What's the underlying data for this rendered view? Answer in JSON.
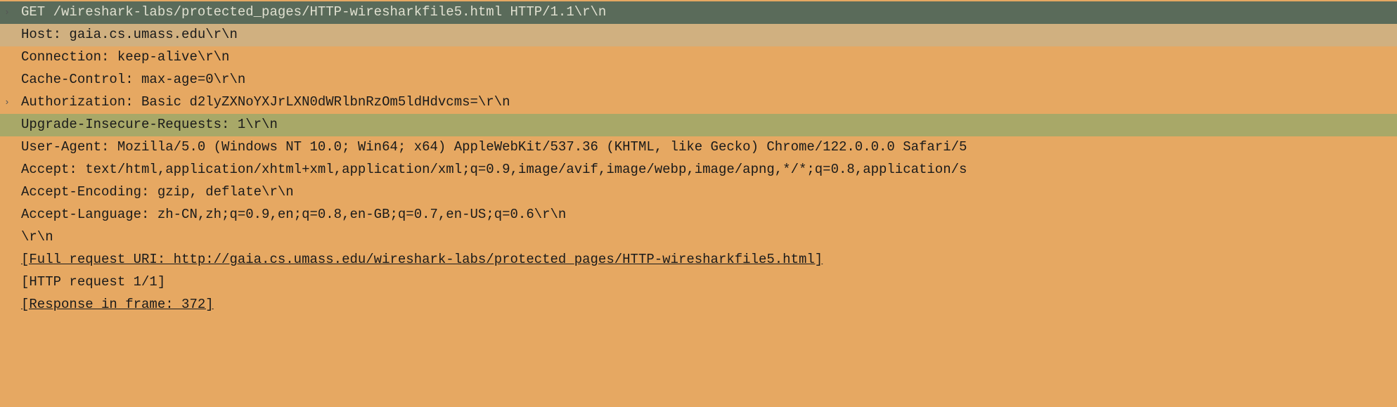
{
  "lines": [
    {
      "text": "GET /wireshark-labs/protected_pages/HTTP-wiresharkfile5.html HTTP/1.1\\r\\n",
      "style": "selected-request",
      "expandable": true,
      "marker": "›"
    },
    {
      "text": "Host: gaia.cs.umass.edu\\r\\n",
      "style": "highlight-tan"
    },
    {
      "text": "Connection: keep-alive\\r\\n"
    },
    {
      "text": "Cache-Control: max-age=0\\r\\n"
    },
    {
      "text": "Authorization: Basic d2lyZXNoYXJrLXN0dWRlbnRzOm5ldHdvcms=\\r\\n",
      "expandable": true,
      "marker": "›"
    },
    {
      "text": "Upgrade-Insecure-Requests: 1\\r\\n",
      "style": "highlight-olive"
    },
    {
      "text": "User-Agent: Mozilla/5.0 (Windows NT 10.0; Win64; x64) AppleWebKit/537.36 (KHTML, like Gecko) Chrome/122.0.0.0 Safari/5"
    },
    {
      "text": "Accept: text/html,application/xhtml+xml,application/xml;q=0.9,image/avif,image/webp,image/apng,*/*;q=0.8,application/s"
    },
    {
      "text": "Accept-Encoding: gzip, deflate\\r\\n"
    },
    {
      "text": "Accept-Language: zh-CN,zh;q=0.9,en;q=0.8,en-GB;q=0.7,en-US;q=0.6\\r\\n"
    },
    {
      "text": "\\r\\n"
    },
    {
      "text": "[Full request URI: http://gaia.cs.umass.edu/wireshark-labs/protected_pages/HTTP-wiresharkfile5.html]",
      "link": true
    },
    {
      "text": "[HTTP request 1/1]"
    },
    {
      "text": "[Response in frame: 372]",
      "link": true
    }
  ]
}
